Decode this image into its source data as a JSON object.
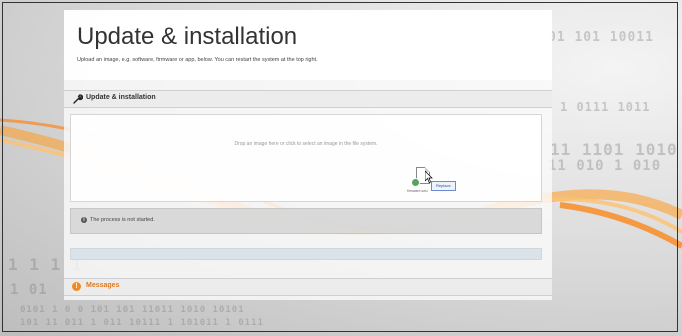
{
  "page": {
    "title": "Update & installation",
    "subtitle": "Upload an image, e.g. software, firmware or app, below. You can restart the system at the top right."
  },
  "update_section": {
    "label": "Update & installation",
    "icon": "wrench-icon"
  },
  "dropzone": {
    "hint": "Drop an image here or click to select an image in the file system.",
    "dragged_file_name": "firmware.swu",
    "drop_tooltip": "Replace"
  },
  "status": {
    "icon": "info-icon",
    "text": "The process is not started."
  },
  "progress": {
    "value": 0
  },
  "messages_section": {
    "label": "Messages",
    "icon": "warning-icon"
  },
  "colors": {
    "accent": "#f08a24",
    "panel": "#fafafa",
    "status_bar": "#d7d7d7"
  }
}
